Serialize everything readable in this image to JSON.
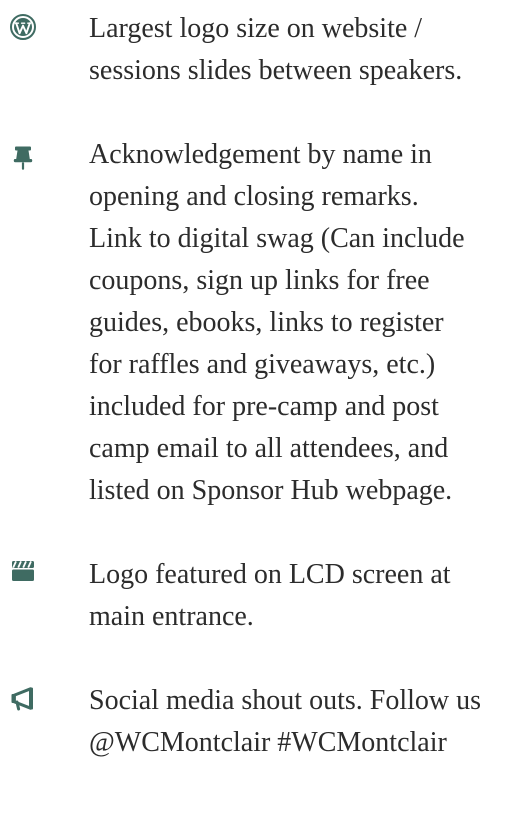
{
  "benefits": [
    {
      "icon": "wordpress-icon",
      "lines": [
        "Largest logo size on website /",
        "sessions slides between speakers."
      ]
    },
    {
      "icon": "thumbtack-icon",
      "lines": [
        "Acknowledgement by name in",
        "opening and closing remarks.",
        "Link to digital swag (Can include",
        "coupons, sign up links for free",
        "guides, ebooks, links to register",
        "for raffles and giveaways, etc.)",
        "included for pre-camp and post",
        "camp email to all attendees, and",
        "listed on Sponsor Hub webpage."
      ]
    },
    {
      "icon": "clapperboard-icon",
      "lines": [
        "Logo featured on LCD screen at",
        "main entrance."
      ]
    },
    {
      "icon": "bullhorn-icon",
      "lines": [
        "Social media shout outs. Follow us",
        "@WCMontclair #WCMontclair"
      ]
    }
  ],
  "colors": {
    "icon": "#3f6b62",
    "text": "#2c2c2c",
    "background": "#ffffff"
  }
}
